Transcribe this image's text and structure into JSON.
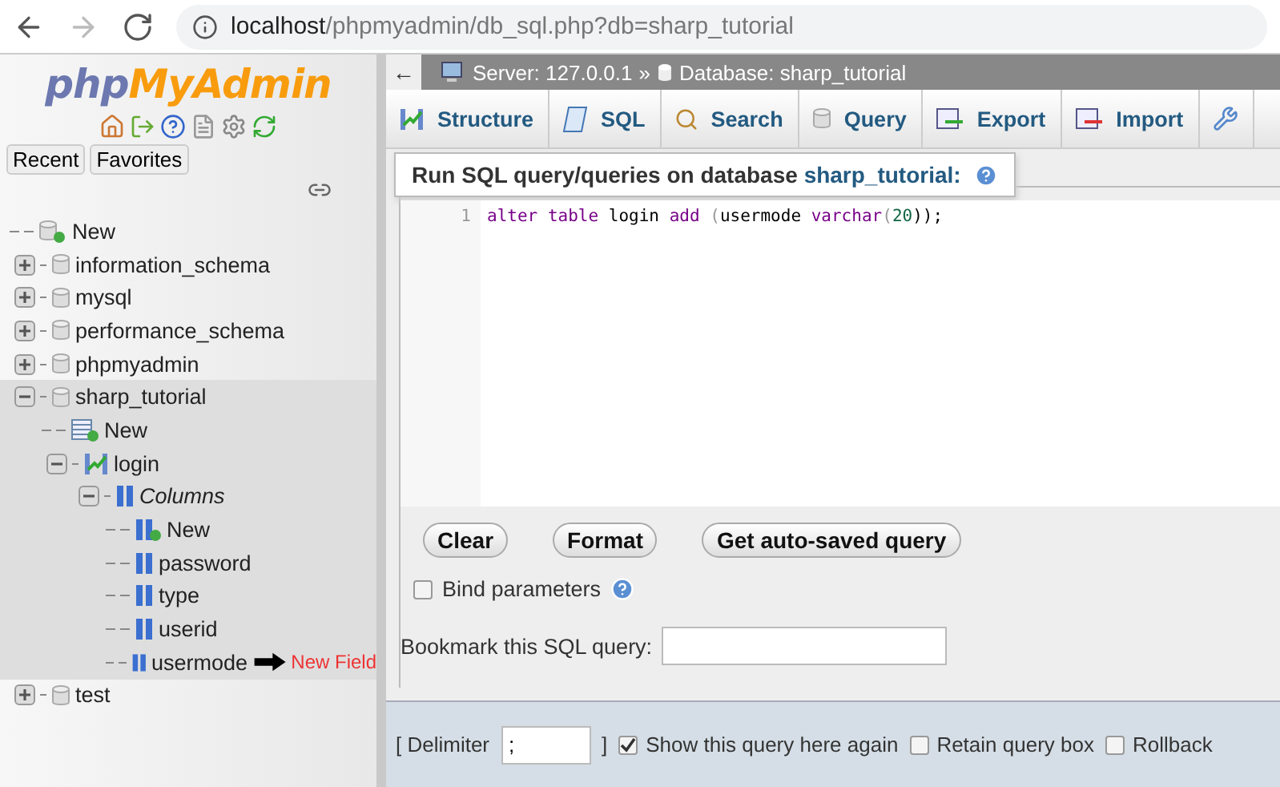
{
  "browser": {
    "nav": [
      {
        "kind": "back",
        "disabled": false
      },
      {
        "kind": "forward",
        "disabled": true
      },
      {
        "kind": "reload",
        "disabled": false
      }
    ],
    "url_host": "localhost",
    "url_path": "/phpmyadmin/db_sql.php?db=sharp_tutorial"
  },
  "sidebar": {
    "logo_php": "php",
    "logo_rest": "MyAdmin",
    "icons": [
      {
        "kind": "home"
      },
      {
        "kind": "exit"
      },
      {
        "kind": "help"
      },
      {
        "kind": "docs"
      },
      {
        "kind": "settings"
      },
      {
        "kind": "reload"
      }
    ],
    "tabs": [
      "Recent",
      "Favorites"
    ],
    "tree": [
      {
        "label": "New",
        "kind": "new"
      },
      {
        "label": "information_schema",
        "kind": "database",
        "expanded": false
      },
      {
        "label": "mysql",
        "kind": "database",
        "expanded": false
      },
      {
        "label": "performance_schema",
        "kind": "database",
        "expanded": false
      },
      {
        "label": "phpmyadmin",
        "kind": "database",
        "expanded": false
      },
      {
        "label": "sharp_tutorial",
        "kind": "database",
        "expanded": true,
        "children": [
          {
            "label": "New",
            "kind": "new-table"
          },
          {
            "label": "login",
            "kind": "table",
            "expanded": true,
            "children": [
              {
                "label": "Columns",
                "kind": "group",
                "expanded": true,
                "children": [
                  {
                    "label": "New",
                    "kind": "new-column"
                  },
                  {
                    "label": "password",
                    "kind": "column"
                  },
                  {
                    "label": "type",
                    "kind": "column"
                  },
                  {
                    "label": "userid",
                    "kind": "column"
                  },
                  {
                    "label": "usermode",
                    "kind": "column",
                    "note": "New Field"
                  }
                ]
              }
            ]
          }
        ]
      },
      {
        "label": "test",
        "kind": "database",
        "expanded": false
      }
    ]
  },
  "breadcrumb": {
    "back": "←",
    "server": "Server: 127.0.0.1",
    "separator": "»",
    "database": "Database: sharp_tutorial"
  },
  "tabs": [
    {
      "label": "Structure",
      "kind": "structure"
    },
    {
      "label": "SQL",
      "kind": "sql"
    },
    {
      "label": "Search",
      "kind": "search"
    },
    {
      "label": "Query",
      "kind": "query"
    },
    {
      "label": "Export",
      "kind": "export"
    },
    {
      "label": "Import",
      "kind": "import"
    },
    {
      "kind": "operations"
    }
  ],
  "legend": {
    "text": "Run SQL query/queries on database ",
    "database": "sharp_tutorial:"
  },
  "editor": {
    "lines": [
      {
        "number": "1",
        "tokens": [
          {
            "text": "alter ",
            "kind": "keyword"
          },
          {
            "text": "table ",
            "kind": "keyword"
          },
          {
            "text": "login ",
            "kind": "plain"
          },
          {
            "text": "add ",
            "kind": "keyword"
          },
          {
            "text": "(",
            "kind": "bracket"
          },
          {
            "text": "usermode ",
            "kind": "plain"
          },
          {
            "text": "varchar",
            "kind": "keyword"
          },
          {
            "text": "(",
            "kind": "bracket"
          },
          {
            "text": "20",
            "kind": "number"
          },
          {
            "text": "));",
            "kind": "plain"
          }
        ]
      }
    ]
  },
  "buttons": [
    "Clear",
    "Format",
    "Get auto-saved query"
  ],
  "bind_parameters": {
    "label": "Bind parameters",
    "checked": false
  },
  "bookmark": {
    "label": "Bookmark this SQL query:"
  },
  "footer": {
    "delimiter_open": "[ Delimiter",
    "delimiter_value": ";",
    "delimiter_close": "]",
    "options": [
      {
        "label": "Show this query here again",
        "checked": true
      },
      {
        "label": "Retain query box",
        "checked": false
      },
      {
        "label": "Rollback",
        "checked": false
      }
    ]
  }
}
